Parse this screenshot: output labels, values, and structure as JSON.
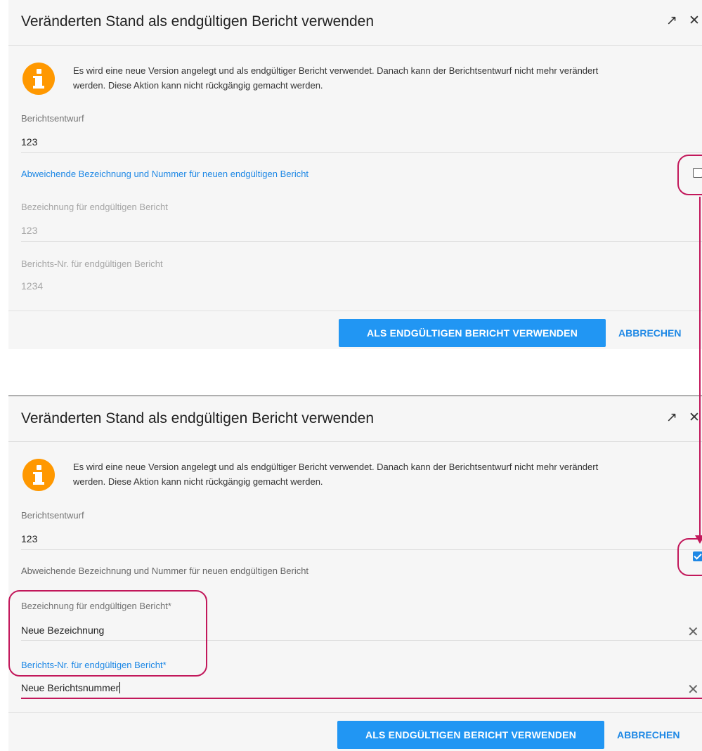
{
  "dialog1": {
    "title": "Veränderten Stand als endgültigen Bericht verwenden",
    "info_text": "Es wird eine neue Version angelegt und als endgültiger Bericht verwendet. Danach kann der Berichtsentwurf nicht mehr verändert werden. Diese Aktion kann nicht rückgängig gemacht werden.",
    "draft_label": "Berichtsentwurf",
    "draft_value": "123",
    "toggle_label": "Abweichende Bezeichnung und Nummer für neuen endgültigen Bericht",
    "toggle_checked": false,
    "name_label": "Bezeichnung für endgültigen Bericht",
    "name_value": "123",
    "number_label": "Berichts-Nr. für endgültigen Bericht",
    "number_value": "1234",
    "primary_button": "ALS ENDGÜLTIGEN BERICHT VERWENDEN",
    "cancel_button": "ABBRECHEN"
  },
  "dialog2": {
    "title": "Veränderten Stand als endgültigen Bericht verwenden",
    "info_text": "Es wird eine neue Version angelegt und als endgültiger Bericht verwendet. Danach kann der Berichtsentwurf nicht mehr verändert werden. Diese Aktion kann nicht rückgängig gemacht werden.",
    "draft_label": "Berichtsentwurf",
    "draft_value": "123",
    "toggle_label": "Abweichende Bezeichnung und Nummer für neuen endgültigen Bericht",
    "toggle_checked": true,
    "name_label": "Bezeichnung für endgültigen Bericht*",
    "name_value": "Neue Bezeichnung",
    "number_label": "Berichts-Nr. für endgültigen Bericht*",
    "number_value": "Neue Berichtsnummer",
    "primary_button": "ALS ENDGÜLTIGEN BERICHT VERWENDEN",
    "cancel_button": "ABBRECHEN"
  },
  "icons": {
    "expand": "↗",
    "close": "✕",
    "clear": "✕",
    "info": "info-icon"
  },
  "colors": {
    "accent": "#2196f3",
    "info": "#ff9800",
    "highlight": "#c2185b"
  }
}
